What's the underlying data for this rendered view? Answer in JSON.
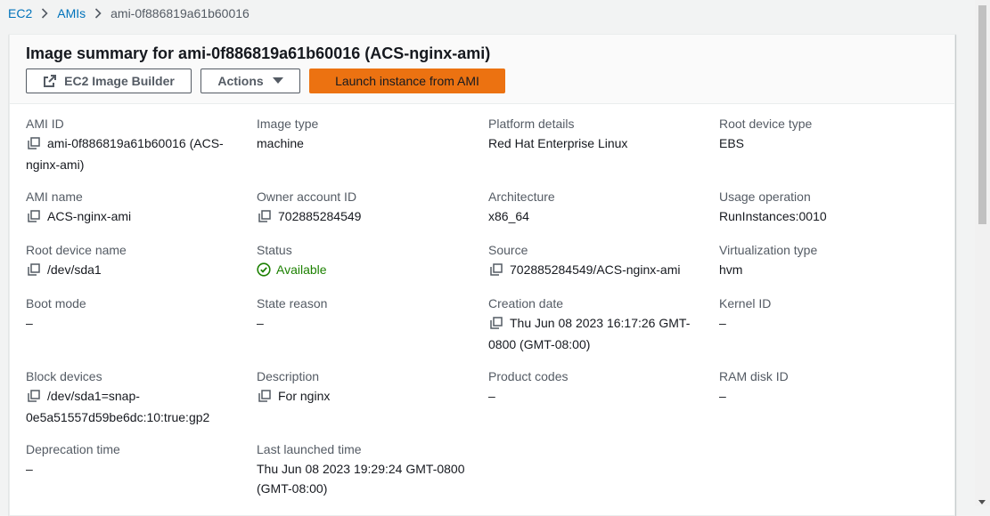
{
  "breadcrumb": {
    "items": [
      "EC2",
      "AMIs"
    ],
    "current": "ami-0f886819a61b60016"
  },
  "header": {
    "title": "Image summary for ami-0f886819a61b60016 (ACS-nginx-ami)",
    "buttons": {
      "builder": "EC2 Image Builder",
      "actions": "Actions",
      "launch": "Launch instance from AMI"
    }
  },
  "details": {
    "ami_id": {
      "label": "AMI ID",
      "value": "ami-0f886819a61b60016 (ACS-",
      "value2": "nginx-ami)"
    },
    "image_type": {
      "label": "Image type",
      "value": "machine"
    },
    "platform_details": {
      "label": "Platform details",
      "value": "Red Hat Enterprise Linux"
    },
    "root_device_type": {
      "label": "Root device type",
      "value": "EBS"
    },
    "ami_name": {
      "label": "AMI name",
      "value": "ACS-nginx-ami"
    },
    "owner_account_id": {
      "label": "Owner account ID",
      "value": "702885284549"
    },
    "architecture": {
      "label": "Architecture",
      "value": "x86_64"
    },
    "usage_operation": {
      "label": "Usage operation",
      "value": "RunInstances:0010"
    },
    "root_device_name": {
      "label": "Root device name",
      "value": "/dev/sda1"
    },
    "status": {
      "label": "Status",
      "value": "Available"
    },
    "source": {
      "label": "Source",
      "value": "702885284549/ACS-nginx-ami"
    },
    "virtualization_type": {
      "label": "Virtualization type",
      "value": "hvm"
    },
    "boot_mode": {
      "label": "Boot mode",
      "value": "–"
    },
    "state_reason": {
      "label": "State reason",
      "value": "–"
    },
    "creation_date": {
      "label": "Creation date",
      "value": "Thu Jun 08 2023 16:17:26 GMT-",
      "value2": "0800 (GMT-08:00)"
    },
    "kernel_id": {
      "label": "Kernel ID",
      "value": "–"
    },
    "block_devices": {
      "label": "Block devices",
      "value": "/dev/sda1=snap-",
      "value2": "0e5a51557d59be6dc:10:true:gp2"
    },
    "description": {
      "label": "Description",
      "value": "For nginx"
    },
    "product_codes": {
      "label": "Product codes",
      "value": "–"
    },
    "ram_disk_id": {
      "label": "RAM disk ID",
      "value": "–"
    },
    "deprecation_time": {
      "label": "Deprecation time",
      "value": "–"
    },
    "last_launched_time": {
      "label": "Last launched time",
      "value": "Thu Jun 08 2023 19:29:24 GMT-0800",
      "value2": "(GMT-08:00)"
    }
  },
  "colors": {
    "link": "#0073bb",
    "primary": "#ec7211",
    "success": "#1d8102"
  },
  "icons": [
    "chevron-right-icon",
    "external-link-icon",
    "caret-down-icon",
    "copy-icon",
    "status-ok-icon"
  ]
}
